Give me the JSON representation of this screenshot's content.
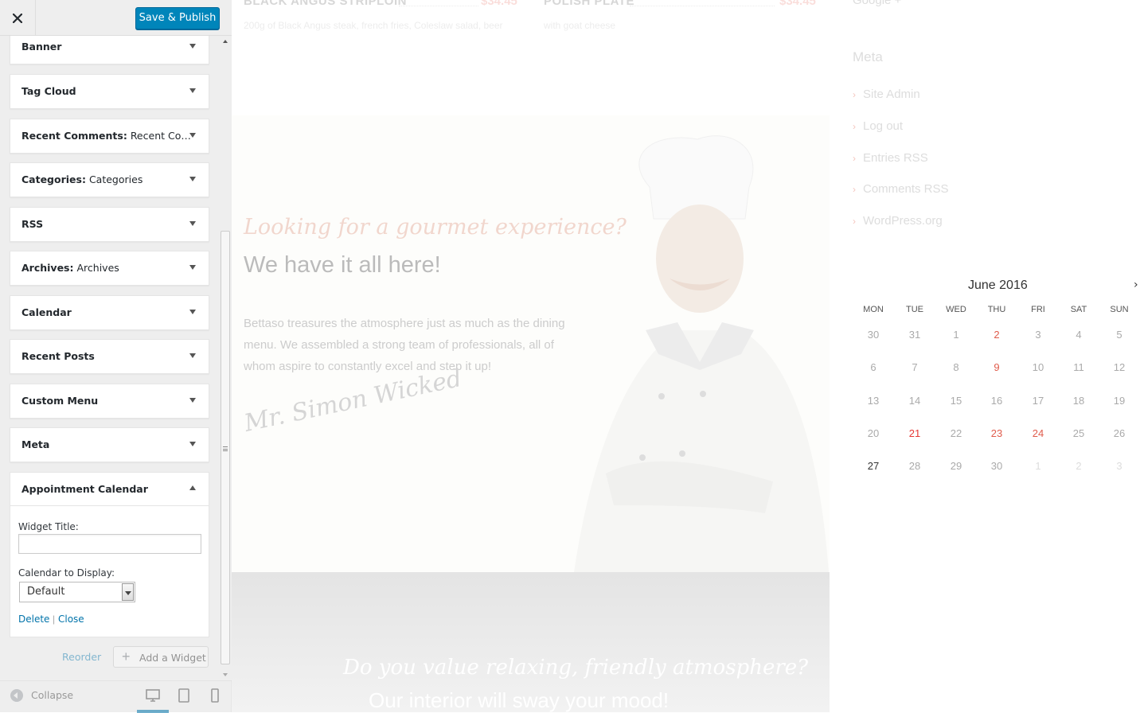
{
  "header": {
    "publish_label": "Save & Publish"
  },
  "widgets": [
    {
      "title": "Banner",
      "subtitle": ""
    },
    {
      "title": "Tag Cloud",
      "subtitle": ""
    },
    {
      "title": "Recent Comments:",
      "subtitle": "Recent Co…"
    },
    {
      "title": "Categories:",
      "subtitle": "Categories"
    },
    {
      "title": "RSS",
      "subtitle": ""
    },
    {
      "title": "Archives:",
      "subtitle": "Archives"
    },
    {
      "title": "Calendar",
      "subtitle": ""
    },
    {
      "title": "Recent Posts",
      "subtitle": ""
    },
    {
      "title": "Custom Menu",
      "subtitle": ""
    },
    {
      "title": "Meta",
      "subtitle": ""
    }
  ],
  "expanded_widget": {
    "title": "Appointment Calendar",
    "widget_title_label": "Widget Title:",
    "widget_title_value": "",
    "calendar_label": "Calendar to Display:",
    "calendar_value": "Default",
    "delete_label": "Delete",
    "separator": "|",
    "close_label": "Close"
  },
  "footer_actions": {
    "reorder_label": "Reorder",
    "add_widget_label": "Add a Widget"
  },
  "sb_footer": {
    "collapse_label": "Collapse"
  },
  "preview": {
    "menu": [
      {
        "name": "BLACK ANGUS STRIPLOIN",
        "price": "$34.45",
        "desc": "200g of Black Angus steak, french fries, Coleslaw salad, beer"
      },
      {
        "name": "POLISH PLATE",
        "price": "$34.45",
        "desc": "with goat cheese"
      }
    ],
    "tagline": "Looking for a gourmet experience?",
    "headline": "We have it all here!",
    "body": "Bettaso  treasures the atmosphere just as much as the dining menu. We assembled a strong team of professionals, all of whom aspire to constantly excel and step it up!",
    "signature": "Mr. Simon Wicked",
    "dark_tagline": "Do you value relaxing, friendly atmosphere?",
    "dark_headline": "Our interior will sway your mood!",
    "google_plus": "Google +",
    "meta_title": "Meta",
    "meta_links": [
      "Site Admin",
      "Log out",
      "Entries RSS",
      "Comments RSS",
      "WordPress.org"
    ]
  },
  "calendar": {
    "month": "June 2016",
    "next": "›",
    "days_of_week": [
      "MON",
      "TUE",
      "WED",
      "THU",
      "FRI",
      "SAT",
      "SUN"
    ],
    "weeks": [
      [
        "30",
        "31",
        "1",
        "2",
        "3",
        "4",
        "5"
      ],
      [
        "6",
        "7",
        "8",
        "9",
        "10",
        "11",
        "12"
      ],
      [
        "13",
        "14",
        "15",
        "16",
        "17",
        "18",
        "19"
      ],
      [
        "20",
        "21",
        "22",
        "23",
        "24",
        "25",
        "26"
      ],
      [
        "27",
        "28",
        "29",
        "30",
        "1",
        "2",
        "3"
      ]
    ],
    "highlighted_days": [
      "2",
      "9",
      "23",
      "24"
    ],
    "today_day": "21",
    "current_day": "27",
    "colors": {
      "highlight": "#e05c4c",
      "today": "#e53935",
      "accent": "#0085ba"
    }
  }
}
